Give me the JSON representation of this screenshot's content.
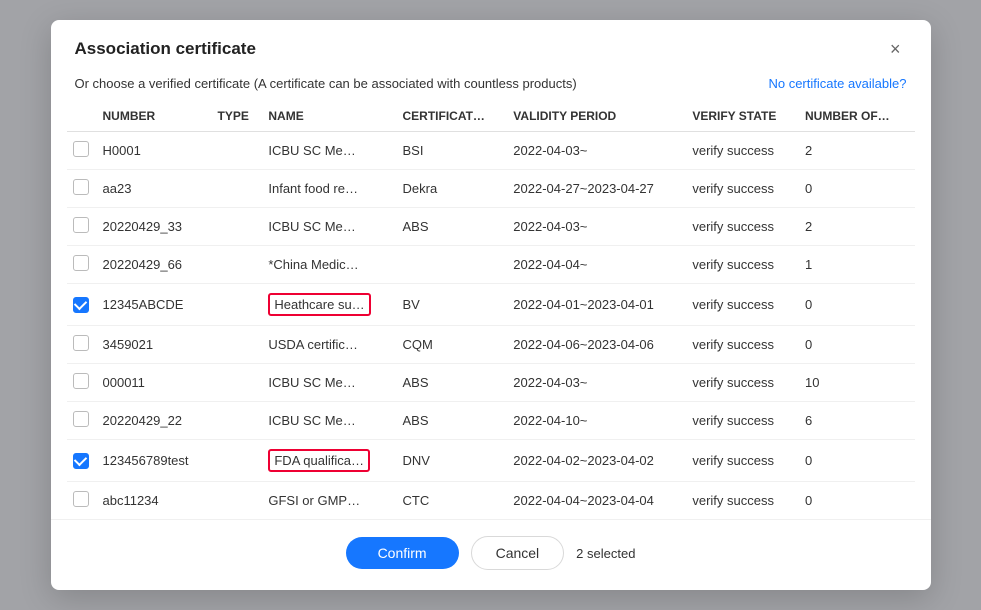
{
  "modal": {
    "title": "Association certificate",
    "subtitle": "Or choose a verified certificate (A certificate can be associated with countless products)",
    "no_cert_link": "No certificate available?",
    "close_label": "×"
  },
  "table": {
    "columns": [
      {
        "key": "checkbox",
        "label": ""
      },
      {
        "key": "number",
        "label": "NUMBER"
      },
      {
        "key": "type",
        "label": "TYPE"
      },
      {
        "key": "name",
        "label": "NAME"
      },
      {
        "key": "certificat",
        "label": "CERTIFICAT…"
      },
      {
        "key": "validity",
        "label": "VALIDITY PERIOD"
      },
      {
        "key": "verify",
        "label": "VERIFY STATE"
      },
      {
        "key": "number_of",
        "label": "NUMBER OF…"
      }
    ],
    "rows": [
      {
        "id": 1,
        "checked": false,
        "number": "H0001",
        "type": "",
        "name": "ICBU SC Me…",
        "certificat": "BSI",
        "validity": "2022-04-03~",
        "verify": "verify success",
        "number_of": "2",
        "highlight_name": false
      },
      {
        "id": 2,
        "checked": false,
        "number": "aa23",
        "type": "",
        "name": "Infant food re…",
        "certificat": "Dekra",
        "validity": "2022-04-27~2023-04-27",
        "verify": "verify success",
        "number_of": "0",
        "highlight_name": false
      },
      {
        "id": 3,
        "checked": false,
        "number": "20220429_33",
        "type": "",
        "name": "ICBU SC Me…",
        "certificat": "ABS",
        "validity": "2022-04-03~",
        "verify": "verify success",
        "number_of": "2",
        "highlight_name": false
      },
      {
        "id": 4,
        "checked": false,
        "number": "20220429_66",
        "type": "",
        "name": "*China Medic…",
        "certificat": "",
        "validity": "2022-04-04~",
        "verify": "verify success",
        "number_of": "1",
        "highlight_name": false
      },
      {
        "id": 5,
        "checked": true,
        "number": "12345ABCDE",
        "type": "",
        "name": "Heathcare su…",
        "certificat": "BV",
        "validity": "2022-04-01~2023-04-01",
        "verify": "verify success",
        "number_of": "0",
        "highlight_name": true
      },
      {
        "id": 6,
        "checked": false,
        "number": "3459021",
        "type": "",
        "name": "USDA certific…",
        "certificat": "CQM",
        "validity": "2022-04-06~2023-04-06",
        "verify": "verify success",
        "number_of": "0",
        "highlight_name": false
      },
      {
        "id": 7,
        "checked": false,
        "number": "000011",
        "type": "",
        "name": "ICBU SC Me…",
        "certificat": "ABS",
        "validity": "2022-04-03~",
        "verify": "verify success",
        "number_of": "10",
        "highlight_name": false
      },
      {
        "id": 8,
        "checked": false,
        "number": "20220429_22",
        "type": "",
        "name": "ICBU SC Me…",
        "certificat": "ABS",
        "validity": "2022-04-10~",
        "verify": "verify success",
        "number_of": "6",
        "highlight_name": false
      },
      {
        "id": 9,
        "checked": true,
        "number": "123456789test",
        "type": "",
        "name": "FDA qualifica…",
        "certificat": "DNV",
        "validity": "2022-04-02~2023-04-02",
        "verify": "verify success",
        "number_of": "0",
        "highlight_name": true
      },
      {
        "id": 10,
        "checked": false,
        "number": "abc11234",
        "type": "",
        "name": "GFSI or GMP…",
        "certificat": "CTC",
        "validity": "2022-04-04~2023-04-04",
        "verify": "verify success",
        "number_of": "0",
        "highlight_name": false
      }
    ]
  },
  "footer": {
    "confirm_label": "Confirm",
    "cancel_label": "Cancel",
    "selected_text": "2 selected"
  }
}
